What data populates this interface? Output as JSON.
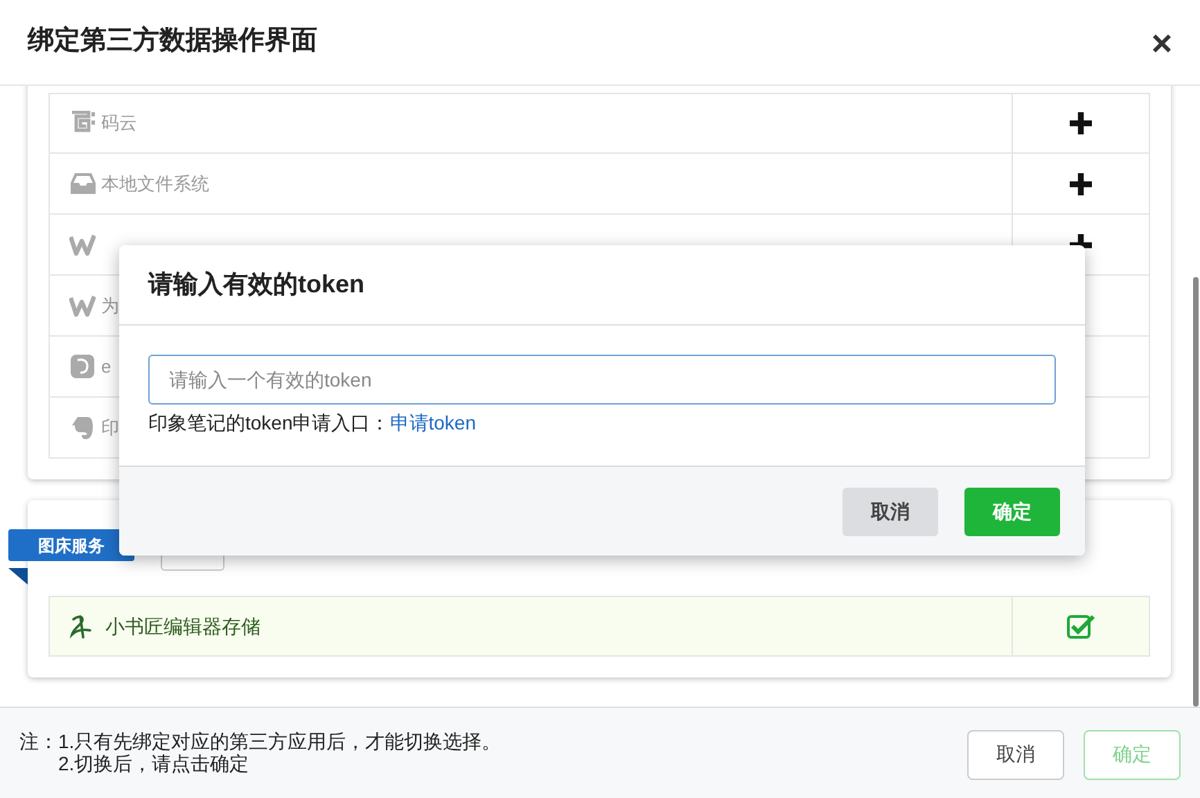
{
  "dialog": {
    "title": "绑定第三方数据操作界面",
    "close": "×"
  },
  "sources": [
    {
      "name": "码云",
      "addable": true
    },
    {
      "name": "本地文件系统",
      "addable": true
    },
    {
      "addable": true
    },
    {
      "name": "为"
    },
    {
      "name": "e"
    },
    {
      "name": "印"
    }
  ],
  "image_service": {
    "label": "图床服务",
    "items": [
      {
        "name": "小书匠编辑器存储",
        "checked": true
      }
    ]
  },
  "token_modal": {
    "title": "请输入有效的token",
    "input": {
      "placeholder": "请输入一个有效的token"
    },
    "help": {
      "text": "印象笔记的token申请入口：",
      "link": "申请token"
    },
    "buttons": [
      {
        "label": "取消",
        "kind": "secondary"
      },
      {
        "label": "确定",
        "kind": "primary"
      }
    ]
  },
  "footer": {
    "note_label": "注：",
    "notes": [
      "1.只有先绑定对应的第三方应用后，才能切换选择。",
      "2.切换后，请点击确定"
    ],
    "buttons": [
      {
        "label": "取消",
        "kind": "default",
        "disabled": false
      },
      {
        "label": "确定",
        "kind": "primary",
        "disabled": true
      }
    ]
  }
}
